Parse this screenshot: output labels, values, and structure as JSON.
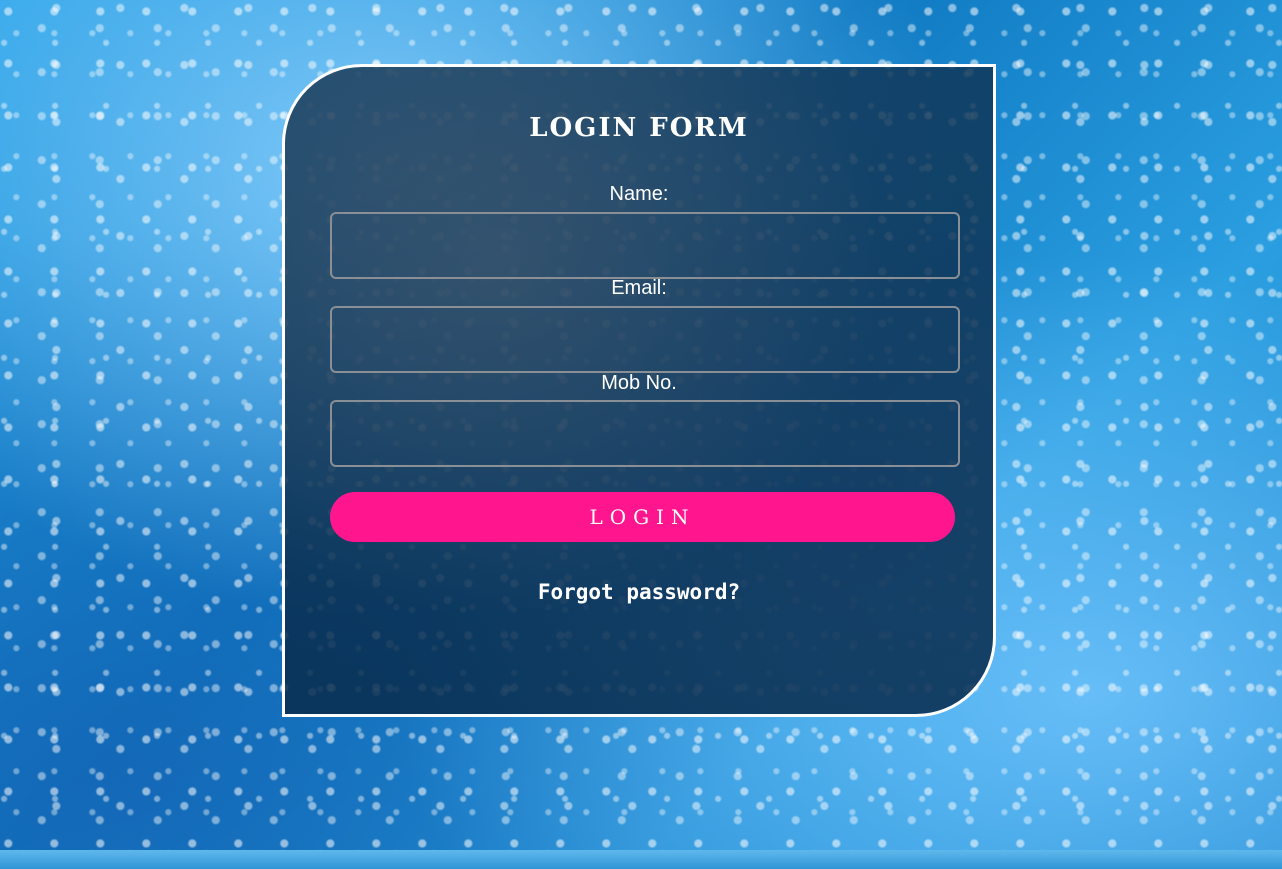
{
  "form": {
    "title": "LOGIN FORM",
    "fields": [
      {
        "label": "Name:",
        "value": "",
        "placeholder": ""
      },
      {
        "label": "Email:",
        "value": "",
        "placeholder": ""
      },
      {
        "label": "Mob No.",
        "value": "",
        "placeholder": ""
      }
    ],
    "submit_label": "LOGIN",
    "forgot_label": "Forgot password?"
  },
  "colors": {
    "button": "#ff168f",
    "card_border": "#ffffff",
    "input_border": "#8a8f96",
    "text": "#ffffff"
  }
}
